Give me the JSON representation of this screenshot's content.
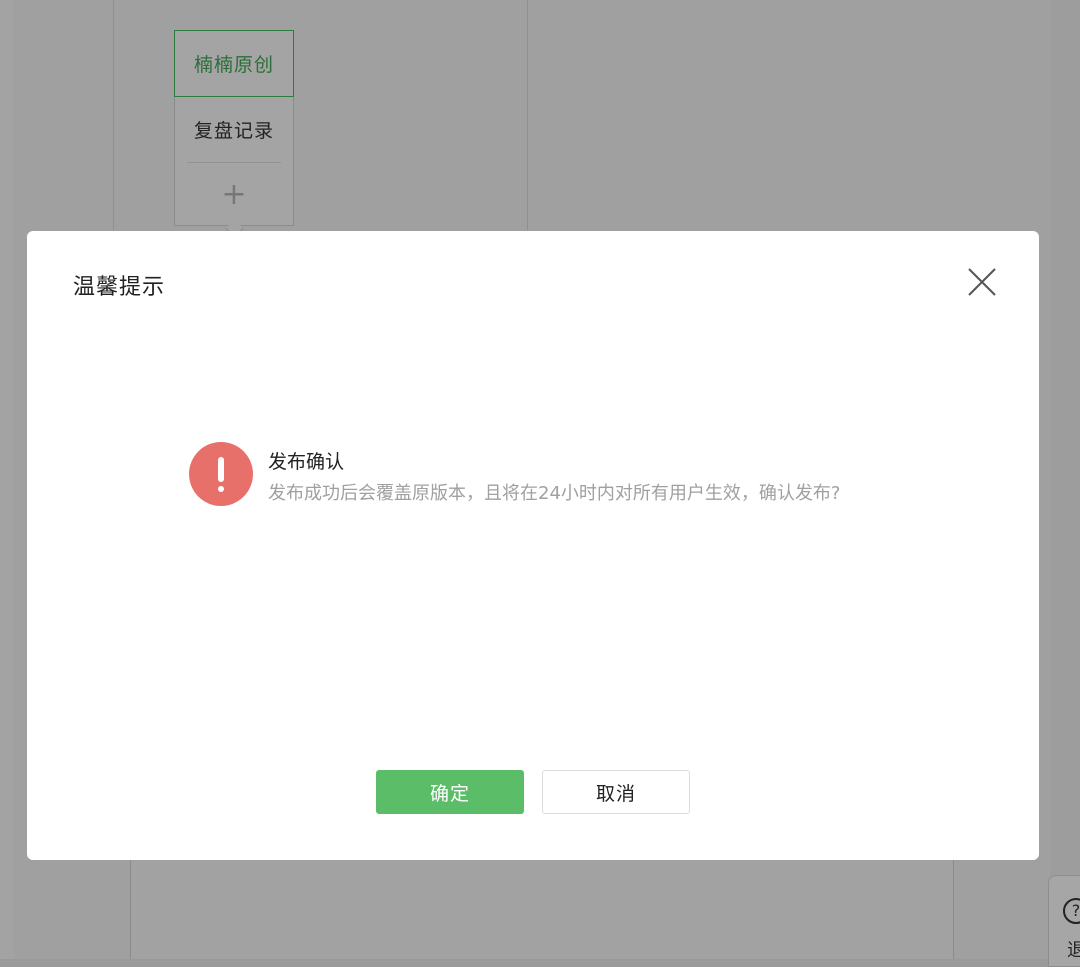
{
  "background": {
    "menu": {
      "items": [
        {
          "label": "楠楠原创",
          "active": true
        },
        {
          "label": "复盘记录",
          "active": false
        }
      ],
      "add_label": "+"
    },
    "help": {
      "icon": "question-circle-icon",
      "label": "退"
    }
  },
  "dialog": {
    "title": "温馨提示",
    "close_icon": "close-icon",
    "alert_icon": "exclamation-circle-icon",
    "alert_color": "#e8706a",
    "message_title": "发布确认",
    "message_body": "发布成功后会覆盖原版本，且将在24小时内对所有用户生效，确认发布?",
    "confirm_label": "确定",
    "cancel_label": "取消",
    "confirm_color": "#5cbd69"
  }
}
